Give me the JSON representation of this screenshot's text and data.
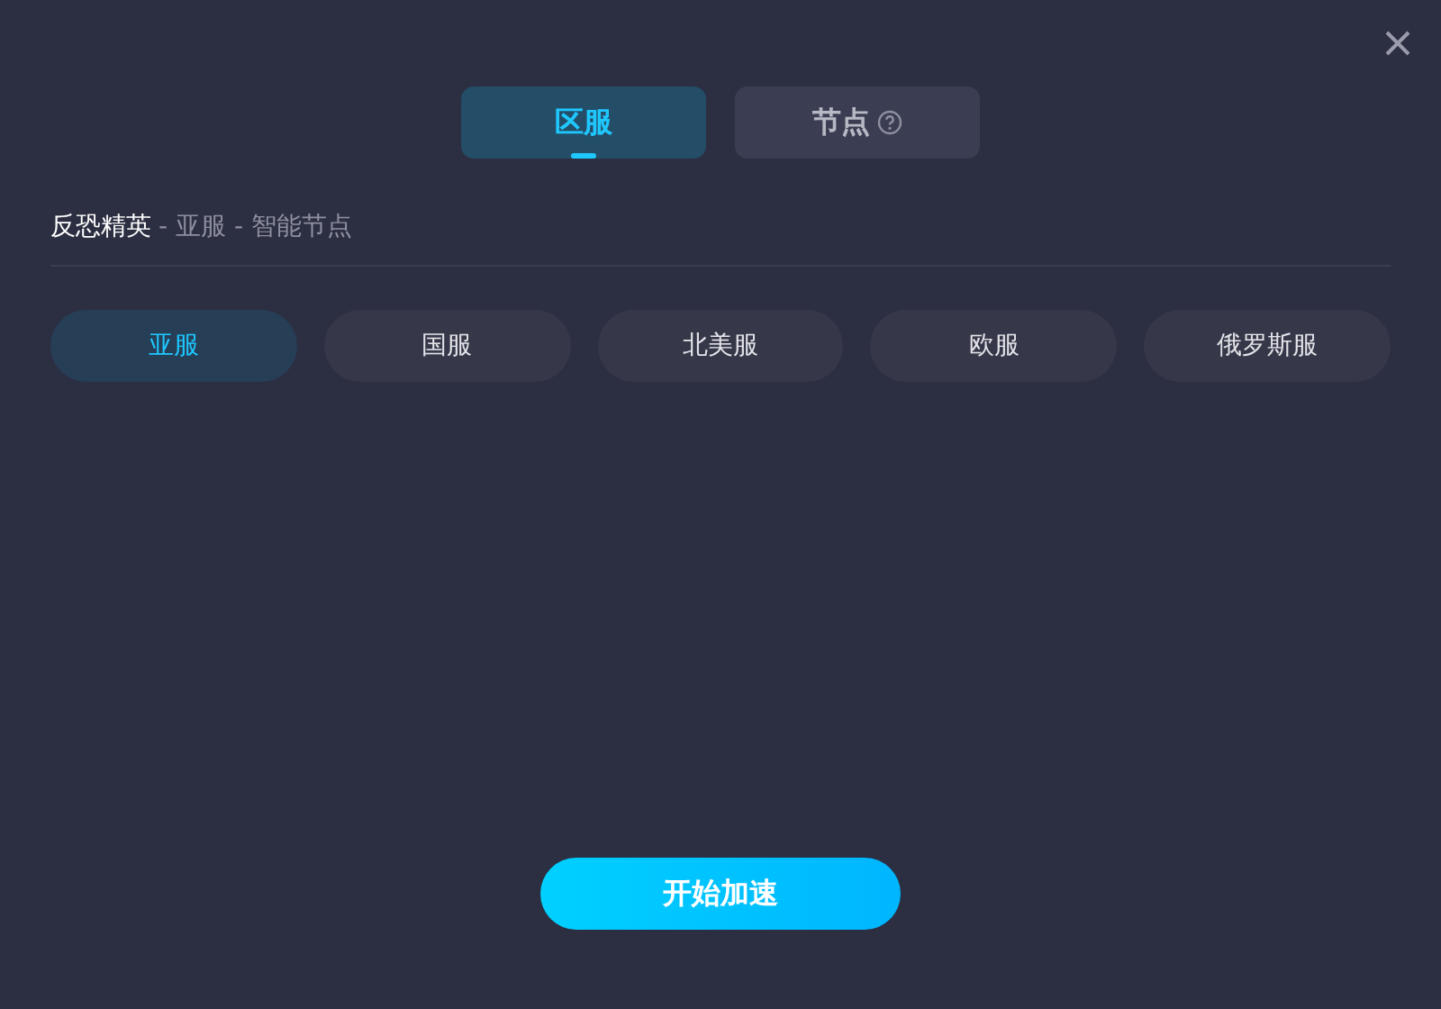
{
  "tabs": [
    {
      "label": "区服",
      "selected": true,
      "help": false
    },
    {
      "label": "节点",
      "selected": false,
      "help": true
    }
  ],
  "breadcrumb": {
    "game": "反恐精英",
    "path": "- 亚服 - 智能节点"
  },
  "regions": [
    {
      "label": "亚服",
      "selected": true
    },
    {
      "label": "国服",
      "selected": false
    },
    {
      "label": "北美服",
      "selected": false
    },
    {
      "label": "欧服",
      "selected": false
    },
    {
      "label": "俄罗斯服",
      "selected": false
    }
  ],
  "start_button": "开始加速"
}
